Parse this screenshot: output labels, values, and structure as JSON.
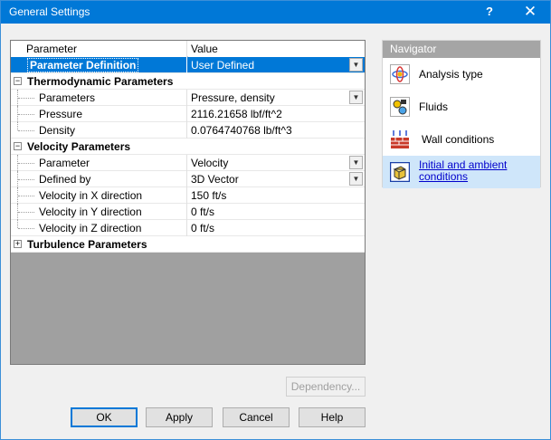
{
  "window": {
    "title": "General Settings",
    "help_glyph": "?",
    "close_glyph": "✕"
  },
  "grid": {
    "col_parameter": "Parameter",
    "col_value": "Value",
    "rows": [
      {
        "label": "Parameter Definition",
        "value": "User Defined"
      },
      {
        "label": "Thermodynamic Parameters"
      },
      {
        "label": "Parameters",
        "value": "Pressure, density"
      },
      {
        "label": "Pressure",
        "value": "2116.21658 lbf/ft^2"
      },
      {
        "label": "Density",
        "value": "0.0764740768 lb/ft^3"
      },
      {
        "label": "Velocity Parameters"
      },
      {
        "label": "Parameter",
        "value": "Velocity"
      },
      {
        "label": "Defined by",
        "value": "3D Vector"
      },
      {
        "label": "Velocity in X direction",
        "value": "150 ft/s"
      },
      {
        "label": "Velocity in Y direction",
        "value": "0 ft/s"
      },
      {
        "label": "Velocity in Z direction",
        "value": "0 ft/s"
      },
      {
        "label": "Turbulence Parameters"
      }
    ],
    "expander_open": "−",
    "expander_closed": "+"
  },
  "navigator": {
    "title": "Navigator",
    "items": [
      {
        "label": "Analysis type",
        "icon": "analysis-type-icon"
      },
      {
        "label": "Fluids",
        "icon": "fluids-icon"
      },
      {
        "label": "Wall conditions",
        "icon": "wall-conditions-icon"
      },
      {
        "label_line1": "Initial and ambient",
        "label_line2": "conditions",
        "icon": "initial-conditions-icon"
      }
    ]
  },
  "buttons": {
    "dependency": "Dependency...",
    "ok": "OK",
    "apply": "Apply",
    "cancel": "Cancel",
    "help": "Help"
  },
  "colors": {
    "title_bar": "#0078d7",
    "selection": "#0078d7",
    "nav_header": "#a5a5a5",
    "nav_active": "#cfe6fa",
    "grid_empty": "#a0a0a0"
  }
}
